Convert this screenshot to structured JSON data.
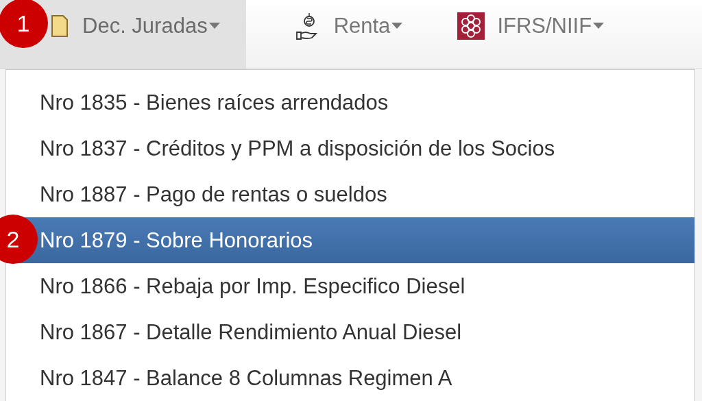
{
  "navbar": {
    "tabs": [
      {
        "label": "Dec. Juradas",
        "kind": "document",
        "selected": true,
        "callout": "1"
      },
      {
        "label": "Renta",
        "kind": "money",
        "selected": false
      },
      {
        "label": "IFRS/NIIF",
        "kind": "emblem",
        "selected": false
      }
    ]
  },
  "dropdown": {
    "items": [
      {
        "label": "Nro 1835 - Bienes raíces arrendados",
        "selected": false
      },
      {
        "label": "Nro 1837 - Créditos y PPM a disposición de los Socios",
        "selected": false
      },
      {
        "label": "Nro 1887 - Pago de rentas o sueldos",
        "selected": false
      },
      {
        "label": "Nro 1879 - Sobre Honorarios",
        "selected": true,
        "callout": "2"
      },
      {
        "label": "Nro 1866 - Rebaja por Imp. Especifico Diesel",
        "selected": false
      },
      {
        "label": "Nro 1867 - Detalle Rendimiento Anual Diesel",
        "selected": false
      },
      {
        "label": "Nro 1847 - Balance 8 Columnas Regimen A",
        "selected": false
      }
    ]
  }
}
